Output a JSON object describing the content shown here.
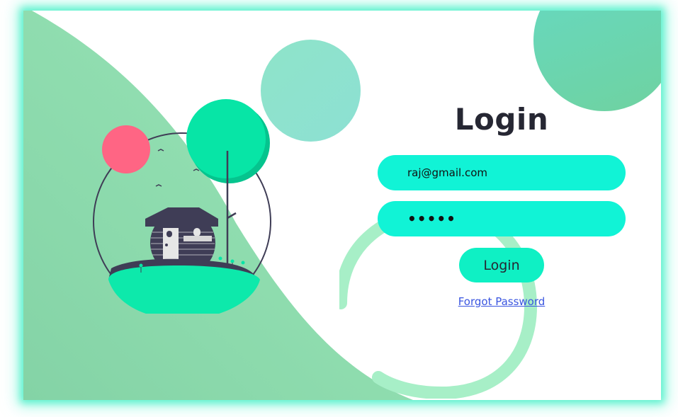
{
  "login": {
    "title": "Login",
    "email_value": "raj@gmail.com",
    "password_value": "•••••",
    "login_button_label": "Login",
    "forgot_password_label": "Forgot Password"
  },
  "colors": {
    "accent": "#11f3d6",
    "glow": "#5ff2cf",
    "wave": "#8ddfb0",
    "sun": "#ff6584",
    "tree": "#07e5a6",
    "house": "#3f3d56"
  },
  "illustration": {
    "icon": "house-on-hill-illustration"
  }
}
